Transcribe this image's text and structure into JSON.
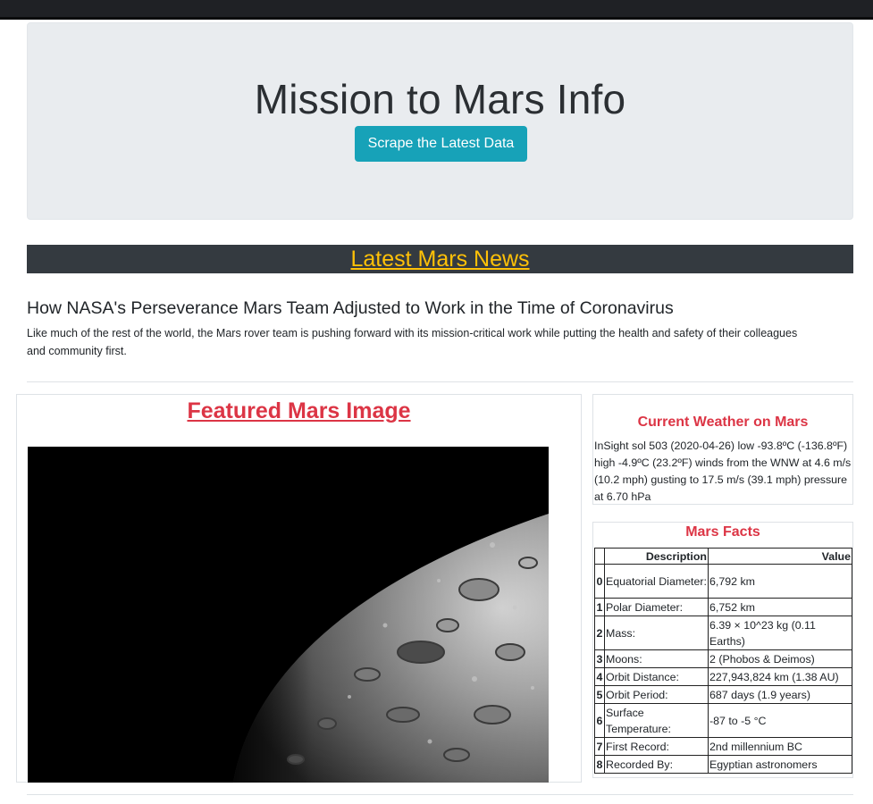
{
  "header": {
    "title": "Mission to Mars Info",
    "scrape_button": "Scrape the Latest Data"
  },
  "news": {
    "section_heading": "Latest Mars News",
    "title": "How NASA's Perseverance Mars Team Adjusted to Work in the Time of Coronavirus",
    "paragraph": "Like much of the rest of the world, the Mars rover team is pushing forward with its mission-critical work while putting the health and safety of their colleagues and community first."
  },
  "featured": {
    "heading": "Featured Mars Image"
  },
  "weather": {
    "heading": "Current Weather on Mars",
    "text": "InSight sol 503 (2020-04-26) low -93.8ºC (-136.8ºF) high -4.9ºC (23.2ºF) winds from the WNW at 4.6 m/s (10.2 mph) gusting to 17.5 m/s (39.1 mph) pressure at 6.70 hPa"
  },
  "facts": {
    "heading": "Mars Facts",
    "columns": [
      "",
      "Description",
      "Value"
    ],
    "rows": [
      {
        "index": "0",
        "description": "Equatorial Diameter:",
        "value": "6,792 km"
      },
      {
        "index": "1",
        "description": "Polar Diameter:",
        "value": "6,752 km"
      },
      {
        "index": "2",
        "description": "Mass:",
        "value": "6.39 × 10^23 kg (0.11 Earths)"
      },
      {
        "index": "3",
        "description": "Moons:",
        "value": "2 (Phobos & Deimos)"
      },
      {
        "index": "4",
        "description": "Orbit Distance:",
        "value": "227,943,824 km (1.38 AU)"
      },
      {
        "index": "5",
        "description": "Orbit Period:",
        "value": "687 days (1.9 years)"
      },
      {
        "index": "6",
        "description": "Surface Temperature:",
        "value": "-87 to -5 °C"
      },
      {
        "index": "7",
        "description": "First Record:",
        "value": "2nd millennium BC"
      },
      {
        "index": "8",
        "description": "Recorded By:",
        "value": "Egyptian astronomers"
      }
    ]
  },
  "colors": {
    "accent_button": "#17a2b8",
    "news_heading": "#ffc107",
    "section_heading": "#dc3545",
    "dark_bar": "#343a40"
  }
}
